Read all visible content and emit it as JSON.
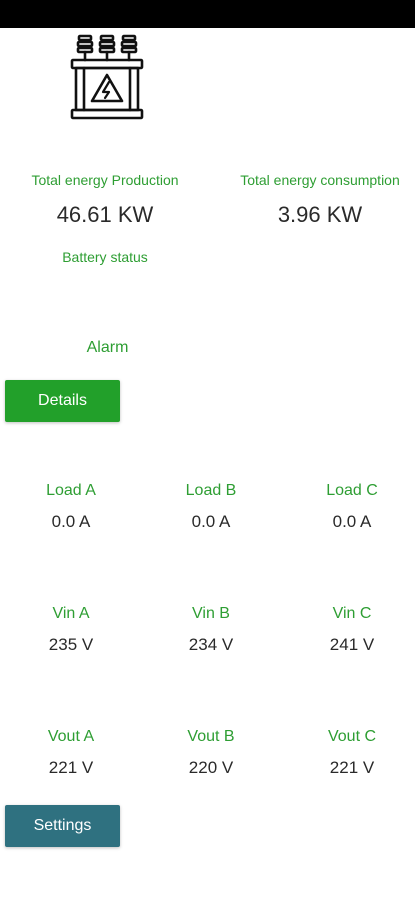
{
  "header": {
    "logo_icon": "transformer-icon"
  },
  "energy": {
    "production_label": "Total energy Production",
    "production_value": "46.61 KW",
    "consumption_label": "Total energy consumption",
    "consumption_value": "3.96 KW"
  },
  "battery": {
    "label": "Battery status"
  },
  "alarm": {
    "label": "Alarm"
  },
  "buttons": {
    "details": "Details",
    "settings": "Settings"
  },
  "load": {
    "a": {
      "label": "Load A",
      "value": "0.0 A"
    },
    "b": {
      "label": "Load B",
      "value": "0.0 A"
    },
    "c": {
      "label": "Load C",
      "value": "0.0 A"
    }
  },
  "vin": {
    "a": {
      "label": "Vin A",
      "value": "235 V"
    },
    "b": {
      "label": "Vin B",
      "value": "234 V"
    },
    "c": {
      "label": "Vin C",
      "value": "241 V"
    }
  },
  "vout": {
    "a": {
      "label": "Vout A",
      "value": "221 V"
    },
    "b": {
      "label": "Vout B",
      "value": "220 V"
    },
    "c": {
      "label": "Vout C",
      "value": "221 V"
    }
  },
  "colors": {
    "accent": "#2e9e33",
    "details_button": "#22a02a",
    "settings_button": "#2f7180"
  }
}
